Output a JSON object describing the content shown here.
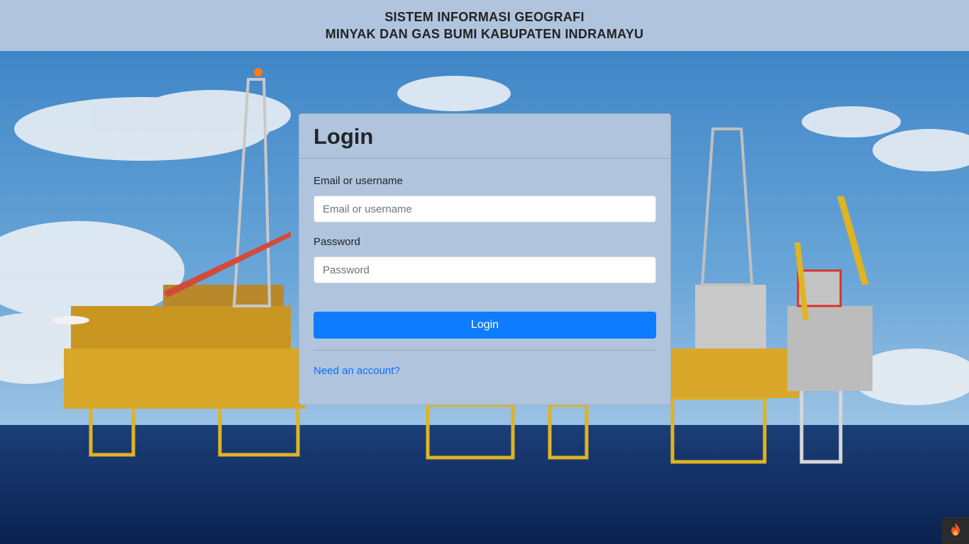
{
  "header": {
    "line1": "SISTEM INFORMASI GEOGRAFI",
    "line2": "MINYAK DAN GAS BUMI KABUPATEN INDRAMAYU"
  },
  "login": {
    "title": "Login",
    "username_label": "Email or username",
    "username_placeholder": "Email or username",
    "password_label": "Password",
    "password_placeholder": "Password",
    "submit_label": "Login",
    "register_link": "Need an account?"
  },
  "colors": {
    "header_bg": "#b0c4de",
    "card_bg": "#b0c4de",
    "primary_button": "#0d7cff",
    "link": "#0d6efd"
  },
  "icons": {
    "corner_badge": "flame-icon"
  }
}
